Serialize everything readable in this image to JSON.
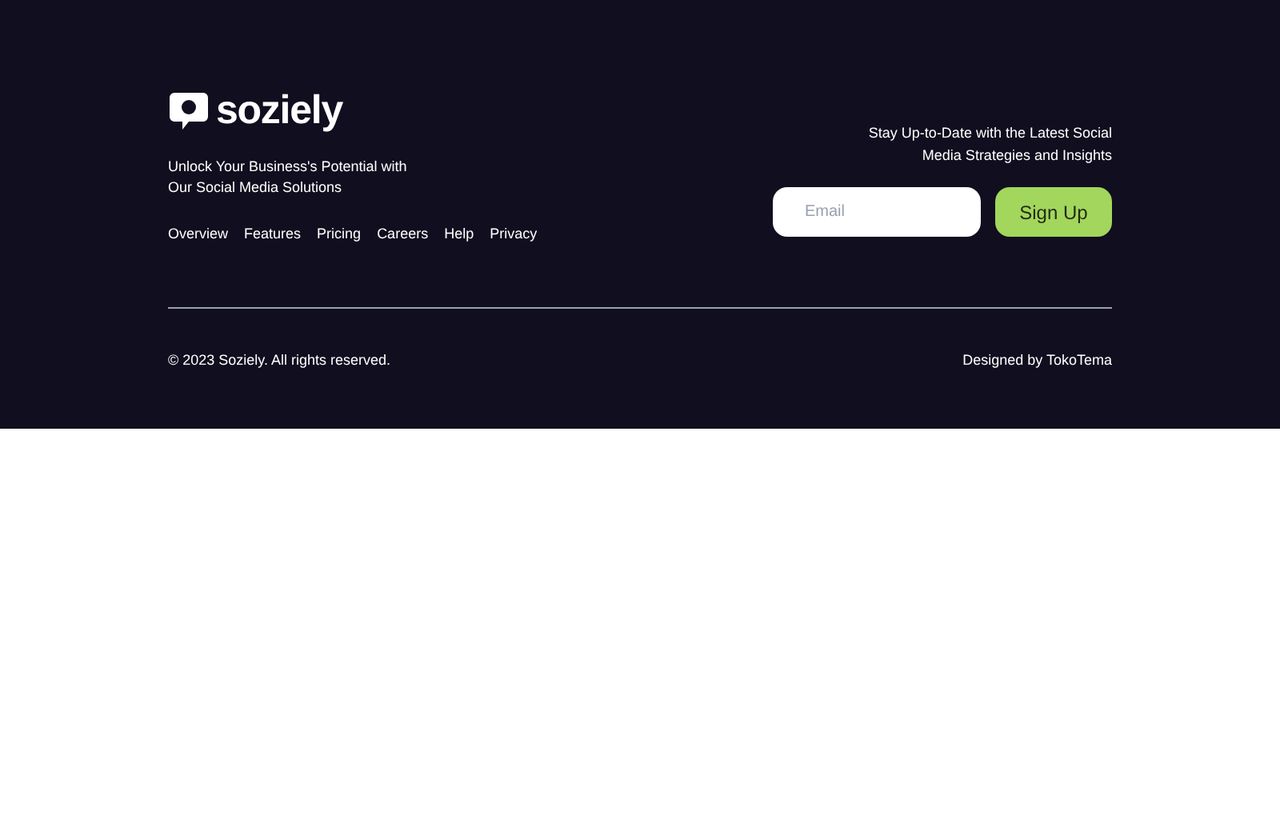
{
  "brand": {
    "name": "soziely",
    "tagline": "Unlock Your Business's Potential with Our Social Media Solutions"
  },
  "nav": [
    "Overview",
    "Features",
    "Pricing",
    "Careers",
    "Help",
    "Privacy"
  ],
  "newsletter": {
    "heading": "Stay Up-to-Date with the Latest Social Media Strategies and Insights",
    "email": {
      "placeholder": "Email"
    },
    "button": "Sign Up"
  },
  "copyright": "© 2023 Soziely. All rights reserved.",
  "credit": "Designed by TokoTema"
}
